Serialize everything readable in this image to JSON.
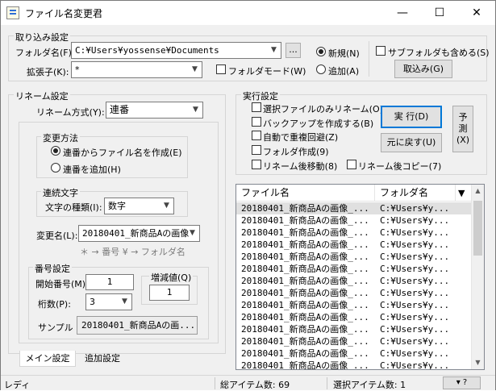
{
  "window": {
    "title": "ファイル名変更君",
    "minimize": "—",
    "maximize": "☐",
    "close": "✕"
  },
  "import": {
    "group": "取り込み設定",
    "folder_label": "フォルダ名(F):",
    "folder_value": "C:¥Users¥yossense¥Documents",
    "browse": "...",
    "ext_label": "拡張子(K):",
    "ext_value": "*",
    "folder_mode": "フォルダモード(W)",
    "radio_new": "新規(N)",
    "radio_add": "追加(A)",
    "include_sub": "サブフォルダも含める(S)",
    "import_button": "取込み(G)"
  },
  "rename": {
    "group": "リネーム設定",
    "method_label": "リネーム方式(Y):",
    "method_value": "連番",
    "change_group": "変更方法",
    "radio_make": "連番からファイル名を作成(E)",
    "radio_append": "連番を追加(H)",
    "serial_group": "連続文字",
    "char_type_label": "文字の種類(I):",
    "char_type_value": "数字",
    "change_name_label": "変更名(L):",
    "change_name_value": "20180401_新商品Aの画像",
    "hint": "＊ → 番号  ¥ → フォルダ名",
    "number_group": "番号設定",
    "start_label": "開始番号(M):",
    "start_value": "1",
    "increment_label": "増減値(Q)",
    "increment_value": "1",
    "digits_label": "桁数(P):",
    "digits_value": "3",
    "sample_label": "サンプル",
    "sample_value": "20180401_新商品Aの画..."
  },
  "exec": {
    "group": "実行設定",
    "options": [
      "選択ファイルのみリネーム(O)",
      "バックアップを作成する(B)",
      "自動で重複回避(Z)",
      "フォルダ作成(9)",
      "リネーム後移動(8)"
    ],
    "copy_after": "リネーム後コピー(7)",
    "run_button": "実 行(D)",
    "undo_button": "元に戻す(U)",
    "preview_button_1": "予",
    "preview_button_2": "測",
    "preview_button_3": "(X)"
  },
  "list": {
    "col_file": "ファイル名",
    "col_folder": "フォルダ名",
    "col_menu": "▼",
    "rows": [
      {
        "file": "20180401_新商品Aの画像_...",
        "folder": "C:¥Users¥y..."
      },
      {
        "file": "20180401_新商品Aの画像_...",
        "folder": "C:¥Users¥y..."
      },
      {
        "file": "20180401_新商品Aの画像_...",
        "folder": "C:¥Users¥y..."
      },
      {
        "file": "20180401_新商品Aの画像_...",
        "folder": "C:¥Users¥y..."
      },
      {
        "file": "20180401_新商品Aの画像_...",
        "folder": "C:¥Users¥y..."
      },
      {
        "file": "20180401_新商品Aの画像_...",
        "folder": "C:¥Users¥y..."
      },
      {
        "file": "20180401_新商品Aの画像_...",
        "folder": "C:¥Users¥y..."
      },
      {
        "file": "20180401_新商品Aの画像_...",
        "folder": "C:¥Users¥y..."
      },
      {
        "file": "20180401_新商品Aの画像_...",
        "folder": "C:¥Users¥y..."
      },
      {
        "file": "20180401_新商品Aの画像_...",
        "folder": "C:¥Users¥y..."
      },
      {
        "file": "20180401_新商品Aの画像_...",
        "folder": "C:¥Users¥y..."
      },
      {
        "file": "20180401_新商品Aの画像_...",
        "folder": "C:¥Users¥y..."
      },
      {
        "file": "20180401_新商品Aの画像_...",
        "folder": "C:¥Users¥y..."
      },
      {
        "file": "20180401_新商品Aの画像_...",
        "folder": "C:¥Users¥y..."
      }
    ]
  },
  "tabs": [
    "メイン設定",
    "追加設定"
  ],
  "status": {
    "ready": "レディ",
    "total": "総アイテム数:  69",
    "selected": "選択アイテム数:  1",
    "help_button": "▾ ?"
  },
  "colors": {
    "accent": "#0078d7",
    "face": "#f0f0f0"
  }
}
